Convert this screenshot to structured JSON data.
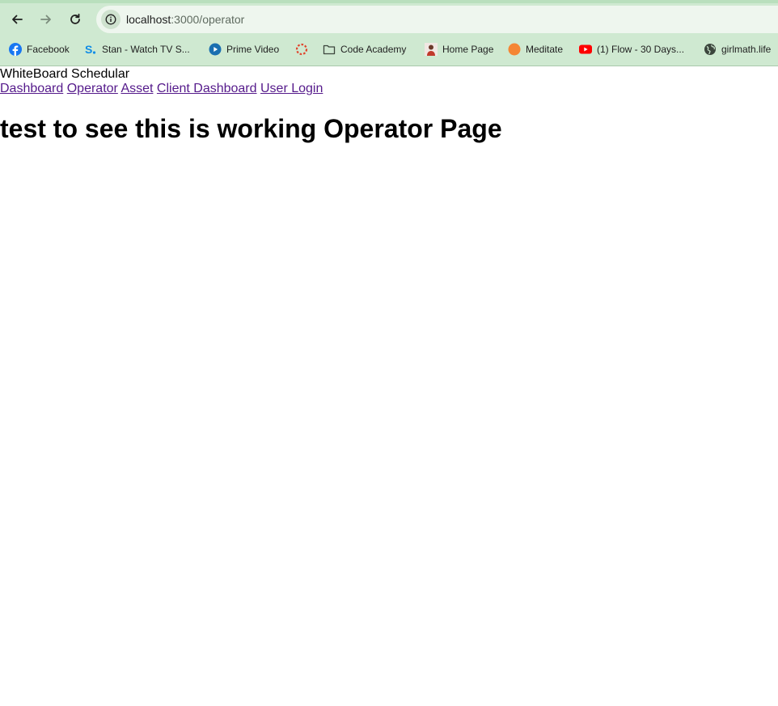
{
  "browser": {
    "url_host": "localhost",
    "url_path": ":3000/operator",
    "bookmarks": [
      {
        "label": "Facebook",
        "icon": "facebook-icon"
      },
      {
        "label": "Stan - Watch TV S...",
        "icon": "stan-icon"
      },
      {
        "label": "Prime Video",
        "icon": "prime-video-icon"
      },
      {
        "label": "",
        "icon": "loading-ring-icon"
      },
      {
        "label": "Code Academy",
        "icon": "folder-icon"
      },
      {
        "label": "Home Page",
        "icon": "profile-photo-icon"
      },
      {
        "label": "Meditate",
        "icon": "orange-circle-icon"
      },
      {
        "label": "(1) Flow - 30 Days...",
        "icon": "youtube-icon"
      },
      {
        "label": "girlmath.life",
        "icon": "globe-icon"
      }
    ]
  },
  "page": {
    "app_title": "WhiteBoard Schedular",
    "nav": [
      {
        "label": "Dashboard"
      },
      {
        "label": "Operator"
      },
      {
        "label": "Asset"
      },
      {
        "label": "Client Dashboard"
      },
      {
        "label": "User Login"
      }
    ],
    "heading": "test to see this is working Operator Page"
  },
  "colors": {
    "chrome_bg": "#cfe9d1",
    "omnibox_bg": "#eef6ee",
    "visited_link": "#551a8b"
  }
}
